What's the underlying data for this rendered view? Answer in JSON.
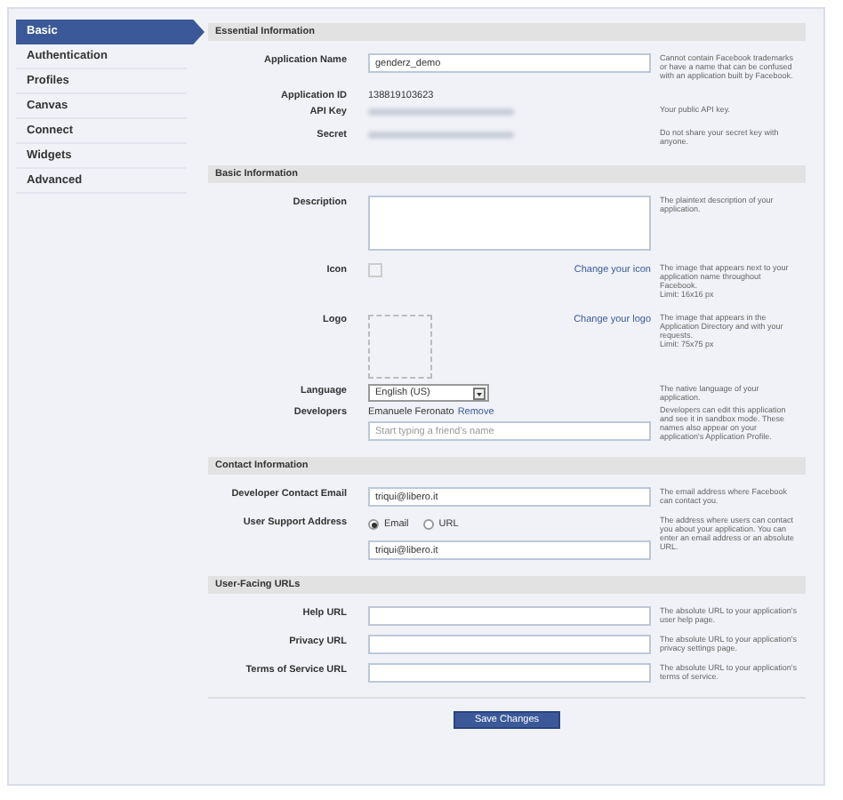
{
  "sidebar": {
    "items": [
      {
        "label": "Basic",
        "selected": true
      },
      {
        "label": "Authentication",
        "selected": false
      },
      {
        "label": "Profiles",
        "selected": false
      },
      {
        "label": "Canvas",
        "selected": false
      },
      {
        "label": "Connect",
        "selected": false
      },
      {
        "label": "Widgets",
        "selected": false
      },
      {
        "label": "Advanced",
        "selected": false
      }
    ]
  },
  "sections": [
    {
      "title": "Essential Information",
      "rows": [
        {
          "kind": "input",
          "label": "Application Name",
          "value": "genderz_demo",
          "help": "Cannot contain Facebook trademarks or have a name that can be confused with an application built by Facebook."
        },
        {
          "kind": "static",
          "label": "Application ID",
          "value": "138819103623"
        },
        {
          "kind": "redacted",
          "label": "API Key",
          "help": "Your public API key."
        },
        {
          "kind": "redacted",
          "label": "Secret",
          "help": "Do not share your secret key with anyone."
        }
      ]
    },
    {
      "title": "Basic Information",
      "rows": [
        {
          "kind": "textarea",
          "label": "Description",
          "help": "The plaintext description of your application."
        },
        {
          "kind": "icon",
          "label": "Icon",
          "link": "Change your icon",
          "help": "The image that appears next to your application name throughout Facebook.",
          "limit": "Limit: 16x16 px"
        },
        {
          "kind": "logo",
          "label": "Logo",
          "link": "Change your logo",
          "help": "The image that appears in the Application Directory and with your requests.",
          "limit": "Limit: 75x75 px"
        },
        {
          "kind": "select",
          "label": "Language",
          "value": "English (US)",
          "help": "The native language of your application."
        },
        {
          "kind": "developers",
          "label": "Developers",
          "name": "Emanuele Feronato",
          "action": "Remove",
          "placeholder": "Start typing a friend's name",
          "help": "Developers can edit this application and see it in sandbox mode. These names also appear on your application's Application Profile."
        }
      ]
    },
    {
      "title": "Contact Information",
      "rows": [
        {
          "kind": "input",
          "label": "Developer Contact Email",
          "value": "triqui@libero.it",
          "help": "The email address where Facebook can contact you."
        },
        {
          "kind": "radio",
          "label": "User Support Address",
          "options": [
            {
              "label": "Email",
              "selected": true
            },
            {
              "label": "URL",
              "selected": false
            }
          ],
          "value": "triqui@libero.it",
          "help": "The address where users can contact you about your application. You can enter an email address or an absolute URL."
        }
      ]
    },
    {
      "title": "User-Facing URLs",
      "rows": [
        {
          "kind": "input",
          "label": "Help URL",
          "help": "The absolute URL to your application's user help page."
        },
        {
          "kind": "input",
          "label": "Privacy URL",
          "help": "The absolute URL to your application's privacy settings page."
        },
        {
          "kind": "input",
          "label": "Terms of Service URL",
          "help": "The absolute URL to your application's terms of service."
        }
      ]
    }
  ],
  "save_button": "Save Changes"
}
